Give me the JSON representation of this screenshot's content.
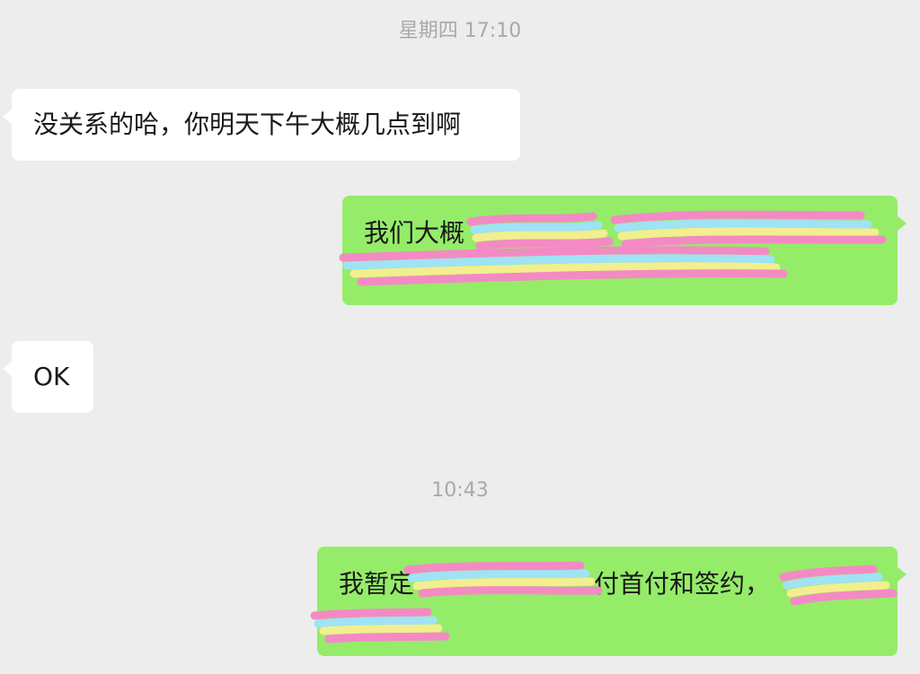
{
  "colors": {
    "background": "#ededed",
    "incoming_bubble": "#ffffff",
    "outgoing_bubble": "#95ec69",
    "timestamp_text": "#a9a9a9",
    "message_text": "#191919",
    "redaction_pink": "#f48ac4",
    "redaction_blue": "#9fe3f5",
    "redaction_yellow": "#f3ee8e"
  },
  "timestamps": {
    "first": "星期四 17:10",
    "second": "10:43"
  },
  "messages": [
    {
      "direction": "incoming",
      "text": "没关系的哈，你明天下午大概几点到啊"
    },
    {
      "direction": "outgoing",
      "text": "我们大概",
      "redacted": true
    },
    {
      "direction": "incoming",
      "text": "OK"
    },
    {
      "direction": "outgoing",
      "text_before": "我暂定",
      "text_middle": "付首付和签约，",
      "redacted": true
    }
  ]
}
